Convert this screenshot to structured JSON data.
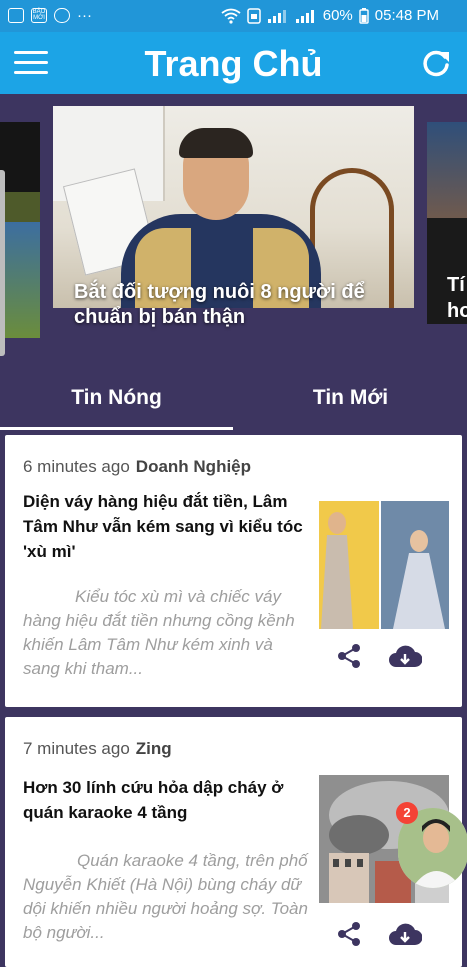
{
  "status_bar": {
    "battery": "60%",
    "time": "05:48 PM",
    "dots": "···",
    "left_icons": [
      "image-icon",
      "baomoi-icon",
      "messenger-icon"
    ],
    "baomoi_label": "BÁO MỚI"
  },
  "app_bar": {
    "title": "Trang Chủ",
    "menu_icon": "hamburger-icon",
    "refresh_icon": "refresh-icon"
  },
  "carousel": {
    "main_caption": "Bắt đối tượng nuôi 8 người để chuẩn bị bán thận",
    "right_caption_fragment": "Tí\nho\nbạ"
  },
  "tabs": [
    {
      "label": "Tin Nóng",
      "active": true
    },
    {
      "label": "Tin Mới",
      "active": false
    }
  ],
  "articles": [
    {
      "time": "6 minutes ago",
      "source": "Doanh Nghiệp",
      "title": "Diện váy hàng hiệu đắt tiền, Lâm Tâm Như vẫn kém sang vì kiểu tóc 'xù mì'",
      "summary": "Kiểu tóc xù mì và chiếc váy hàng hiệu đắt tiền nhưng cồng kềnh khiến Lâm Tâm Như kém xinh và sang khi tham..."
    },
    {
      "time": "7 minutes ago",
      "source": "Zing",
      "title": "Hơn 30 lính cứu hỏa dập cháy ở quán karaoke 4 tầng",
      "summary": "Quán karaoke 4 tầng, trên phố Nguyễn Khiết (Hà Nội) bùng cháy dữ dội khiến nhiều người hoảng sợ. Toàn bộ người..."
    }
  ],
  "chat_head": {
    "badge": "2"
  },
  "colors": {
    "app_bar": "#1ca4e6",
    "background": "#3d3560",
    "status_bar": "#2196d8"
  }
}
